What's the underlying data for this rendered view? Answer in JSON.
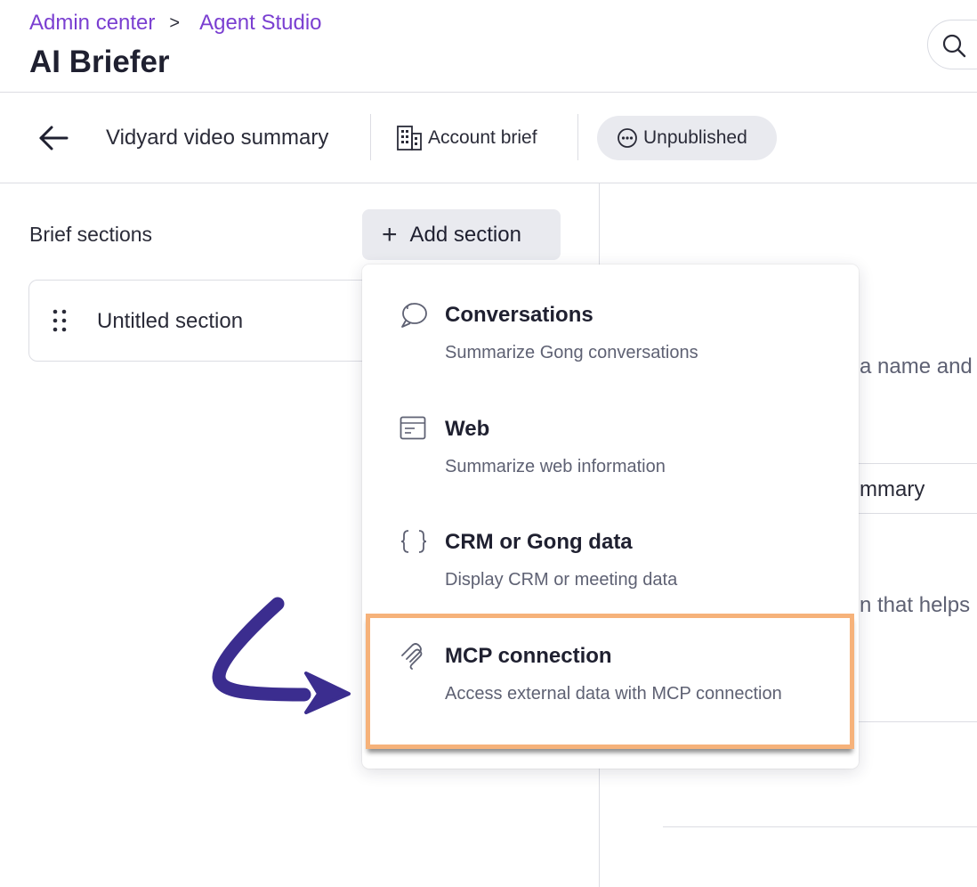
{
  "breadcrumb": {
    "items": [
      "Admin center",
      "Agent Studio"
    ],
    "separator": ">"
  },
  "page": {
    "title": "AI Briefer"
  },
  "toolbar": {
    "title": "Vidyard video summary",
    "account_brief": "Account brief",
    "status": "Unpublished"
  },
  "left_panel": {
    "heading": "Brief sections",
    "add_button": "Add section",
    "sections": [
      {
        "label": "Untitled section"
      }
    ]
  },
  "right_panel": {
    "fragments": [
      "a name and",
      "mmary",
      "n that helps"
    ]
  },
  "dropdown": {
    "items": [
      {
        "title": "Conversations",
        "description": "Summarize Gong conversations",
        "icon": "chat-bubbles-icon"
      },
      {
        "title": "Web",
        "description": "Summarize web information",
        "icon": "browser-window-icon"
      },
      {
        "title": "CRM or Gong data",
        "description": "Display CRM or meeting data",
        "icon": "curly-braces-icon"
      },
      {
        "title": "MCP connection",
        "description": "Access external data with MCP connection",
        "icon": "mcp-link-icon"
      }
    ]
  },
  "colors": {
    "accent": "#7a3fd1",
    "highlight": "#f6b27a",
    "arrow": "#3b2d8f",
    "pill_bg": "#e9eaef"
  }
}
